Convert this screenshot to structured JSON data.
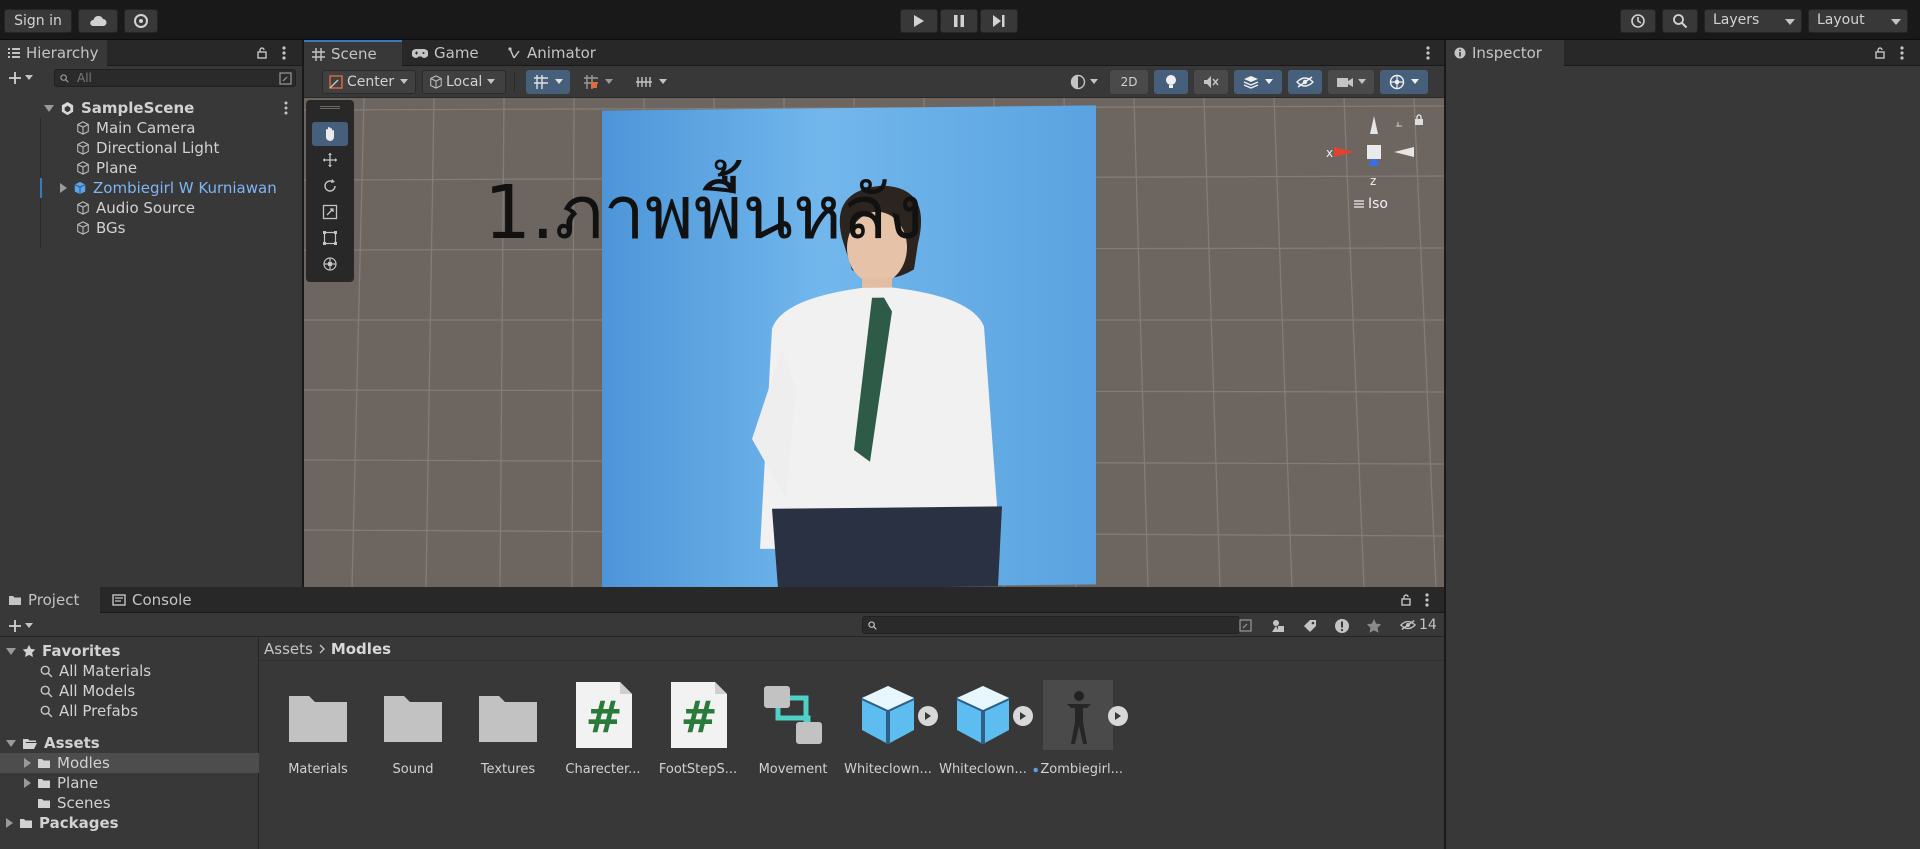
{
  "toolbar": {
    "sign_in": "Sign in",
    "layers_label": "Layers",
    "layout_label": "Layout"
  },
  "hierarchy": {
    "tab": "Hierarchy",
    "search_placeholder": "All",
    "scene": "SampleScene",
    "items": [
      {
        "label": "Main Camera",
        "icon": "gameobject-icon"
      },
      {
        "label": "Directional Light",
        "icon": "gameobject-icon"
      },
      {
        "label": "Plane",
        "icon": "gameobject-icon"
      },
      {
        "label": "Zombiegirl W Kurniawan",
        "icon": "prefab-icon",
        "color": "#7fb4f5"
      },
      {
        "label": "Audio Source",
        "icon": "gameobject-icon"
      },
      {
        "label": "BGs",
        "icon": "gameobject-icon"
      }
    ]
  },
  "scene_view": {
    "tabs": [
      {
        "label": "Scene"
      },
      {
        "label": "Game"
      },
      {
        "label": "Animator"
      }
    ],
    "pivot_label": "Center",
    "space_label": "Local",
    "mode_2d": "2D",
    "overlay_text": "1.ภาพพื้นหลัง",
    "gizmo_x": "x",
    "gizmo_z": "z",
    "gizmo_projection": "Iso",
    "colors": {
      "background": "#6c6560",
      "plane": "#5aa3e0",
      "accent": "#3a79bb"
    }
  },
  "inspector": {
    "tab": "Inspector"
  },
  "project": {
    "tabs": [
      {
        "label": "Project"
      },
      {
        "label": "Console"
      }
    ],
    "hidden_count": "14",
    "favorites": {
      "label": "Favorites",
      "items": [
        "All Materials",
        "All Models",
        "All Prefabs"
      ]
    },
    "assets_tree": {
      "label": "Assets",
      "items": [
        "Modles",
        "Plane",
        "Scenes"
      ]
    },
    "packages_label": "Packages",
    "breadcrumb": [
      "Assets",
      "Modles"
    ],
    "assets": [
      {
        "label": "Materials",
        "icon": "folder-icon"
      },
      {
        "label": "Sound",
        "icon": "folder-icon"
      },
      {
        "label": "Textures",
        "icon": "folder-icon"
      },
      {
        "label": "Charecter...",
        "icon": "script-icon"
      },
      {
        "label": "FootStepS...",
        "icon": "script-icon"
      },
      {
        "label": "Movement",
        "icon": "animator-icon"
      },
      {
        "label": "Whiteclown...",
        "icon": "model-icon"
      },
      {
        "label": "Whiteclown...",
        "icon": "model-icon"
      },
      {
        "label": "Zombiegirl...",
        "icon": "character-icon"
      }
    ]
  }
}
